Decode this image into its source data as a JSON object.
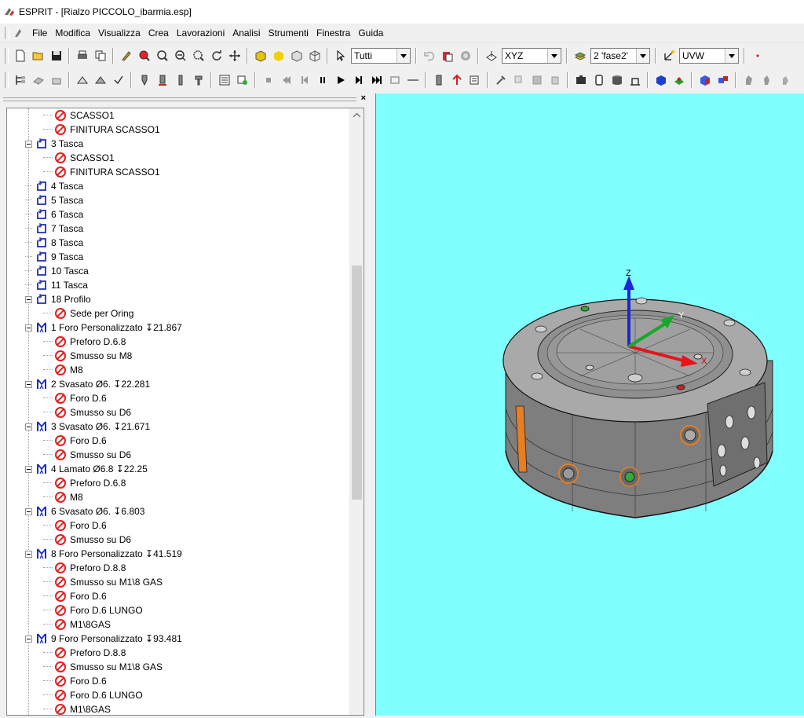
{
  "window": {
    "title": "ESPRIT - [Rialzo PICCOLO_ibarmia.esp]",
    "icon": "esprit-app-icon"
  },
  "menu": {
    "items": [
      "File",
      "Modifica",
      "Visualizza",
      "Crea",
      "Lavorazioni",
      "Analisi",
      "Strumenti",
      "Finestra",
      "Guida"
    ]
  },
  "toolbar": {
    "selection_filter": "Tutti",
    "work_plane": "XYZ",
    "layer": "2 'fase2'",
    "uvw_plane": "UVW"
  },
  "tree": {
    "rows": [
      {
        "label": "SCASSO1",
        "icon": "op-disabled-icon",
        "level": 2
      },
      {
        "label": "FINITURA SCASSO1",
        "icon": "op-disabled-icon",
        "level": 2
      },
      {
        "label": "3 Tasca",
        "icon": "pocket-feature-icon",
        "level": 1,
        "expanded": true
      },
      {
        "label": "SCASSO1",
        "icon": "op-disabled-icon",
        "level": 2
      },
      {
        "label": "FINITURA SCASSO1",
        "icon": "op-disabled-icon",
        "level": 2
      },
      {
        "label": "4 Tasca",
        "icon": "pocket-feature-icon",
        "level": 1
      },
      {
        "label": "5 Tasca",
        "icon": "pocket-feature-icon",
        "level": 1
      },
      {
        "label": "6 Tasca",
        "icon": "pocket-feature-icon",
        "level": 1
      },
      {
        "label": "7 Tasca",
        "icon": "pocket-feature-icon",
        "level": 1
      },
      {
        "label": "8 Tasca",
        "icon": "pocket-feature-icon",
        "level": 1
      },
      {
        "label": "9 Tasca",
        "icon": "pocket-feature-icon",
        "level": 1
      },
      {
        "label": "10 Tasca",
        "icon": "pocket-feature-icon",
        "level": 1
      },
      {
        "label": "11 Tasca",
        "icon": "pocket-feature-icon",
        "level": 1
      },
      {
        "label": "18 Profilo",
        "icon": "pocket-feature-icon",
        "level": 1,
        "expanded": true
      },
      {
        "label": "Sede per Oring",
        "icon": "op-disabled-icon",
        "level": 2
      },
      {
        "label": "1 Foro Personalizzato ↧21.867",
        "icon": "hole-feature-icon",
        "level": 1,
        "expanded": true
      },
      {
        "label": "Preforo D.6.8",
        "icon": "op-disabled-icon",
        "level": 2
      },
      {
        "label": "Smusso su M8",
        "icon": "op-disabled-icon",
        "level": 2
      },
      {
        "label": "M8",
        "icon": "op-disabled-icon",
        "level": 2
      },
      {
        "label": "2 Svasato Ø6. ↧22.281",
        "icon": "hole-feature-icon",
        "level": 1,
        "expanded": true
      },
      {
        "label": "Foro D.6",
        "icon": "op-disabled-icon",
        "level": 2
      },
      {
        "label": "Smusso su D6",
        "icon": "op-disabled-icon",
        "level": 2
      },
      {
        "label": "3 Svasato Ø6. ↧21.671",
        "icon": "hole-feature-icon",
        "level": 1,
        "expanded": true
      },
      {
        "label": "Foro D.6",
        "icon": "op-disabled-icon",
        "level": 2
      },
      {
        "label": "Smusso su D6",
        "icon": "op-disabled-icon",
        "level": 2
      },
      {
        "label": "4 Lamato Ø6.8 ↧22.25",
        "icon": "hole-feature-icon",
        "level": 1,
        "expanded": true
      },
      {
        "label": "Preforo D.6.8",
        "icon": "op-disabled-icon",
        "level": 2
      },
      {
        "label": "M8",
        "icon": "op-disabled-icon",
        "level": 2
      },
      {
        "label": "6 Svasato Ø6. ↧6.803",
        "icon": "hole-feature-icon",
        "level": 1,
        "expanded": true
      },
      {
        "label": "Foro D.6",
        "icon": "op-disabled-icon",
        "level": 2
      },
      {
        "label": "Smusso su D6",
        "icon": "op-disabled-icon",
        "level": 2
      },
      {
        "label": "8 Foro Personalizzato ↧41.519",
        "icon": "hole-feature-icon",
        "level": 1,
        "expanded": true
      },
      {
        "label": "Preforo D.8.8",
        "icon": "op-disabled-icon",
        "level": 2
      },
      {
        "label": "Smusso su M1\\8 GAS",
        "icon": "op-disabled-icon",
        "level": 2
      },
      {
        "label": "Foro D.6",
        "icon": "op-disabled-icon",
        "level": 2
      },
      {
        "label": "Foro D.6 LUNGO",
        "icon": "op-disabled-icon",
        "level": 2
      },
      {
        "label": "M1\\8GAS",
        "icon": "op-disabled-icon",
        "level": 2
      },
      {
        "label": "9 Foro Personalizzato ↧93.481",
        "icon": "hole-feature-icon",
        "level": 1,
        "expanded": true
      },
      {
        "label": "Preforo D.8.8",
        "icon": "op-disabled-icon",
        "level": 2
      },
      {
        "label": "Smusso su M1\\8 GAS",
        "icon": "op-disabled-icon",
        "level": 2
      },
      {
        "label": "Foro D.6",
        "icon": "op-disabled-icon",
        "level": 2
      },
      {
        "label": "Foro D.6 LUNGO",
        "icon": "op-disabled-icon",
        "level": 2
      },
      {
        "label": "M1\\8GAS",
        "icon": "op-disabled-icon",
        "level": 2
      }
    ]
  },
  "viewport": {
    "background": "#80ffff",
    "axes": {
      "x": "X",
      "y": "Y",
      "z": "Z"
    },
    "axis_colors": {
      "x": "#e8141a",
      "y": "#16a82a",
      "z": "#1a26d8"
    }
  }
}
